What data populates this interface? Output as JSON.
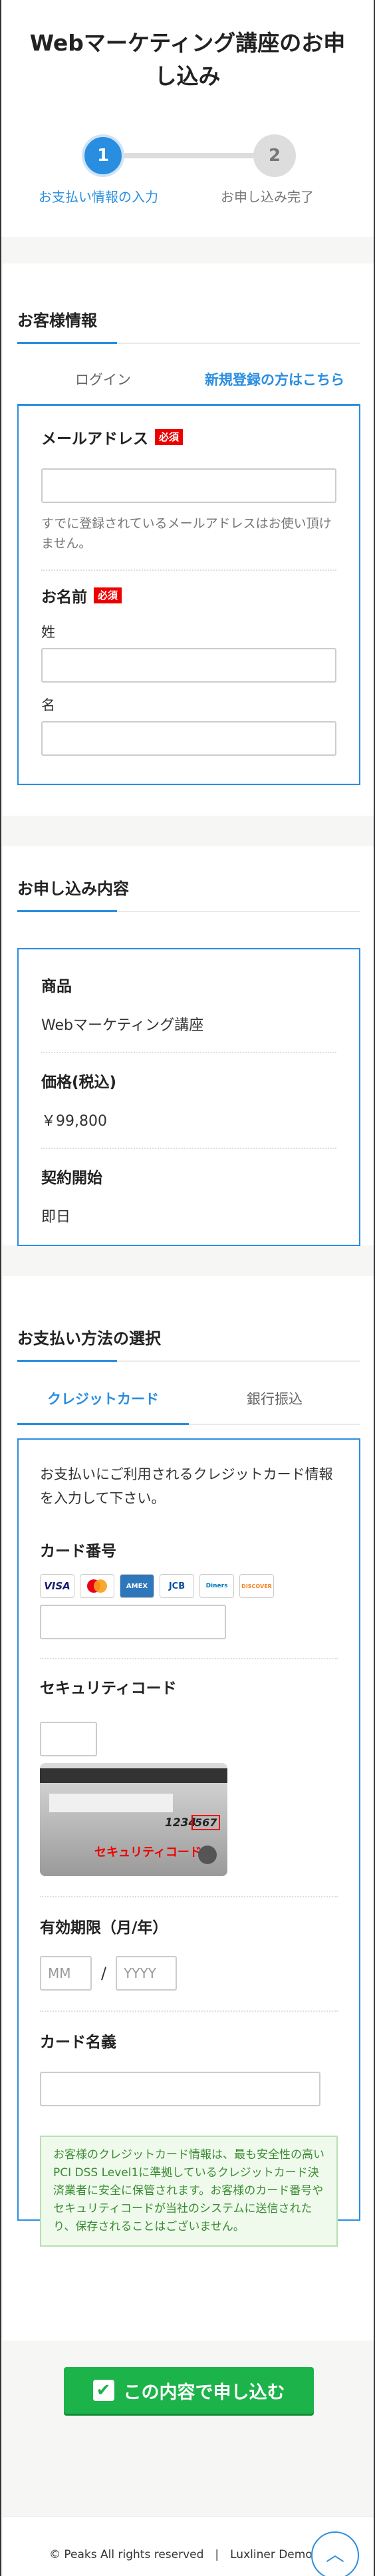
{
  "header": {
    "title": "Webマーケティング講座のお申し込み",
    "steps": [
      {
        "num": "1",
        "label": "お支払い情報の入力"
      },
      {
        "num": "2",
        "label": "お申し込み完了"
      }
    ]
  },
  "customer": {
    "title": "お客様情報",
    "tabs": [
      "ログイン",
      "新規登録の方はこちら"
    ],
    "required_label": "必須",
    "email_label": "メールアドレス",
    "email_note": "すでに登録されているメールアドレスはお使い頂けません。",
    "name_label": "お名前",
    "last_name_label": "姓",
    "first_name_label": "名"
  },
  "order": {
    "title": "お申し込み内容",
    "product_label": "商品",
    "product_value": "Webマーケティング講座",
    "price_label": "価格(税込)",
    "price_value": "￥99,800",
    "start_label": "契約開始",
    "start_value": "即日"
  },
  "payment": {
    "title": "お支払い方法の選択",
    "tabs": [
      "クレジットカード",
      "銀行振込"
    ],
    "intro": "お支払いにご利用されるクレジットカード情報を入力して下さい。",
    "card_number_label": "カード番号",
    "card_brands": [
      "VISA",
      "Master",
      "AMEX",
      "JCB",
      "Diners",
      "DISCOVER"
    ],
    "security_label": "セキュリティコード",
    "security_image_caption": "セキュリティコード",
    "security_image_number": "1234",
    "security_image_code": "567",
    "expiry_label": "有効期限（月/年）",
    "expiry_month_placeholder": "MM",
    "expiry_separator": "/",
    "expiry_year_placeholder": "YYYY",
    "holder_label": "カード名義",
    "security_note": "お客様のクレジットカード情報は、最も安全性の高いPCI DSS Level1に準拠しているクレジットカード決済業者に安全に保管されます。お客様のカード番号やセキュリティコードが当社のシステムに送信されたり、保存されることはございません。"
  },
  "submit_label": "この内容で申し込む",
  "footer": {
    "text": "© Peaks All rights reserved　|　Luxliner Demo Site"
  },
  "colors": {
    "accent": "#2a8ee0",
    "required": "#e00000",
    "submit": "#1cb34a"
  }
}
